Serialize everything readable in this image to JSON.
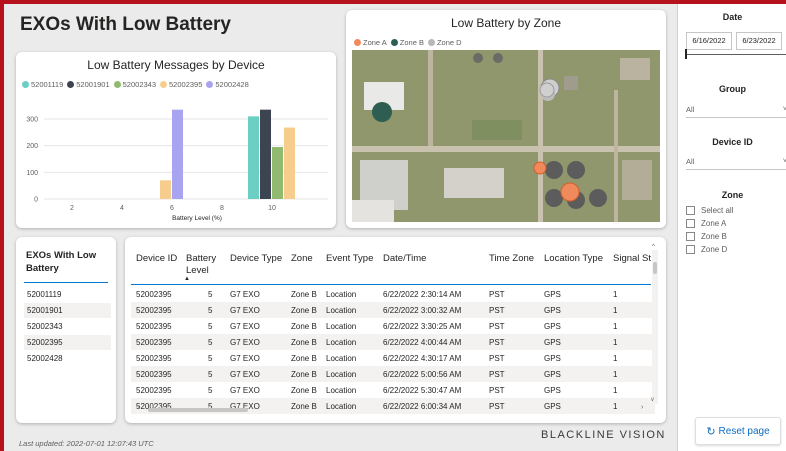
{
  "page_title": "EXOs With Low Battery",
  "bar_card": {
    "title": "Low Battery Messages by Device",
    "legend": [
      {
        "label": "52001119",
        "color": "#6ccfc4"
      },
      {
        "label": "52001901",
        "color": "#3d4451"
      },
      {
        "label": "52002343",
        "color": "#8fba6f"
      },
      {
        "label": "52002395",
        "color": "#f6cd8c"
      },
      {
        "label": "52002428",
        "color": "#a9a4ef"
      }
    ]
  },
  "chart_data": {
    "type": "bar",
    "xlabel": "Battery Level (%)",
    "ylabel": "",
    "x_ticks": [
      "2",
      "4",
      "6",
      "8",
      "10"
    ],
    "y_ticks": [
      "0",
      "100",
      "200",
      "300"
    ],
    "ylim": [
      0,
      360
    ],
    "series": [
      {
        "name": "52001119",
        "color": "#6ccfc4",
        "points": [
          {
            "x": 10,
            "y": 310
          }
        ]
      },
      {
        "name": "52001901",
        "color": "#3d4451",
        "points": [
          {
            "x": 10,
            "y": 335
          }
        ]
      },
      {
        "name": "52002343",
        "color": "#8fba6f",
        "points": [
          {
            "x": 10,
            "y": 195
          }
        ]
      },
      {
        "name": "52002395",
        "color": "#f6cd8c",
        "points": [
          {
            "x": 6,
            "y": 70
          },
          {
            "x": 10,
            "y": 268
          }
        ]
      },
      {
        "name": "52002428",
        "color": "#a9a4ef",
        "points": [
          {
            "x": 6,
            "y": 335
          }
        ]
      }
    ]
  },
  "map_card": {
    "title": "Low Battery by Zone",
    "legend": [
      {
        "label": "Zone A",
        "color": "#f08a5d"
      },
      {
        "label": "Zone B",
        "color": "#2e5d52"
      },
      {
        "label": "Zone D",
        "color": "#b8b8b8"
      }
    ]
  },
  "device_list": {
    "header": "EXOs With Low Battery",
    "items": [
      "52001119",
      "52001901",
      "52002343",
      "52002395",
      "52002428"
    ]
  },
  "table": {
    "columns": [
      "Device ID",
      "Battery Level",
      "Device Type",
      "Zone",
      "Event Type",
      "Date/Time",
      "Time Zone",
      "Location Type",
      "Signal St"
    ],
    "rows": [
      [
        "52002395",
        "5",
        "G7 EXO",
        "Zone B",
        "Location",
        "6/22/2022 2:30:14 AM",
        "PST",
        "GPS",
        "1"
      ],
      [
        "52002395",
        "5",
        "G7 EXO",
        "Zone B",
        "Location",
        "6/22/2022 3:00:32 AM",
        "PST",
        "GPS",
        "1"
      ],
      [
        "52002395",
        "5",
        "G7 EXO",
        "Zone B",
        "Location",
        "6/22/2022 3:30:25 AM",
        "PST",
        "GPS",
        "1"
      ],
      [
        "52002395",
        "5",
        "G7 EXO",
        "Zone B",
        "Location",
        "6/22/2022 4:00:44 AM",
        "PST",
        "GPS",
        "1"
      ],
      [
        "52002395",
        "5",
        "G7 EXO",
        "Zone B",
        "Location",
        "6/22/2022 4:30:17 AM",
        "PST",
        "GPS",
        "1"
      ],
      [
        "52002395",
        "5",
        "G7 EXO",
        "Zone B",
        "Location",
        "6/22/2022 5:00:56 AM",
        "PST",
        "GPS",
        "1"
      ],
      [
        "52002395",
        "5",
        "G7 EXO",
        "Zone B",
        "Location",
        "6/22/2022 5:30:47 AM",
        "PST",
        "GPS",
        "1"
      ],
      [
        "52002395",
        "5",
        "G7 EXO",
        "Zone B",
        "Location",
        "6/22/2022 6:00:34 AM",
        "PST",
        "GPS",
        "1"
      ]
    ]
  },
  "slicers": {
    "date": {
      "title": "Date",
      "start": "6/16/2022",
      "end": "6/23/2022"
    },
    "group": {
      "title": "Group",
      "value": "All"
    },
    "device": {
      "title": "Device ID",
      "value": "All"
    },
    "zone": {
      "title": "Zone",
      "options": [
        "Select all",
        "Zone A",
        "Zone B",
        "Zone D"
      ]
    }
  },
  "reset_label": "Reset page",
  "footer": "Last updated: 2022-07-01 12:07:43 UTC",
  "brand": "BLACKLINE VISION"
}
